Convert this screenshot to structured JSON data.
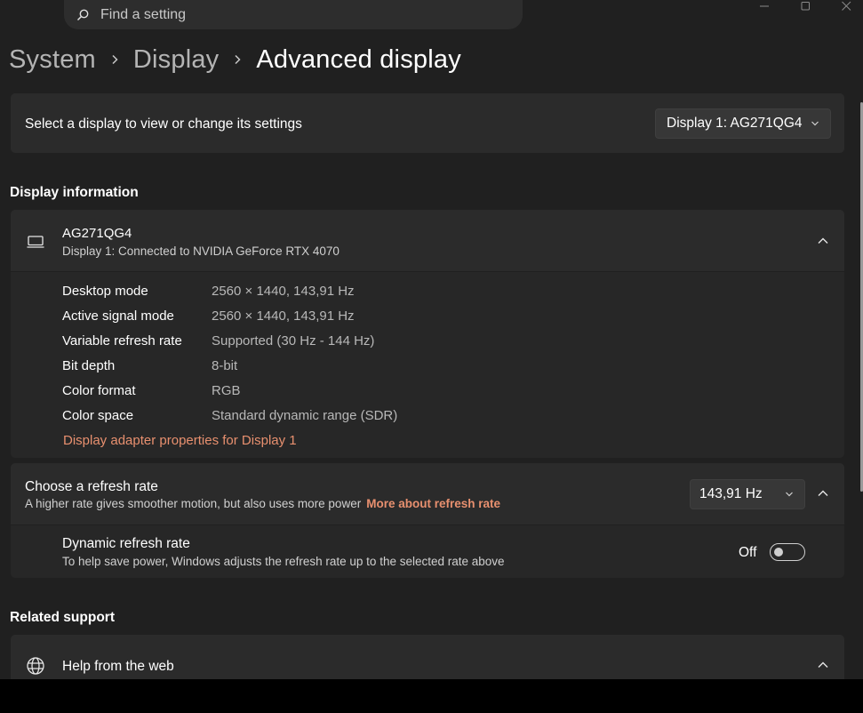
{
  "search": {
    "placeholder": "Find a setting"
  },
  "breadcrumb": {
    "items": [
      "System",
      "Display",
      "Advanced display"
    ]
  },
  "display_select": {
    "label": "Select a display to view or change its settings",
    "selected": "Display 1: AG271QG4"
  },
  "display_information": {
    "section_title": "Display information",
    "monitor_name": "AG271QG4",
    "connection": "Display 1: Connected to NVIDIA GeForce RTX 4070",
    "rows": [
      {
        "key": "Desktop mode",
        "value": "2560 × 1440, 143,91 Hz"
      },
      {
        "key": "Active signal mode",
        "value": "2560 × 1440, 143,91 Hz"
      },
      {
        "key": "Variable refresh rate",
        "value": "Supported (30 Hz - 144 Hz)"
      },
      {
        "key": "Bit depth",
        "value": "8-bit"
      },
      {
        "key": "Color format",
        "value": "RGB"
      },
      {
        "key": "Color space",
        "value": "Standard dynamic range (SDR)"
      }
    ],
    "adapter_link": "Display adapter properties for Display 1"
  },
  "refresh_rate": {
    "title": "Choose a refresh rate",
    "description": "A higher rate gives smoother motion, but also uses more power",
    "more_link": "More about refresh rate",
    "selected": "143,91 Hz"
  },
  "dynamic_refresh": {
    "title": "Dynamic refresh rate",
    "description": "To help save power, Windows adjusts the refresh rate up to the selected rate above",
    "state_label": "Off"
  },
  "related_support": {
    "section_title": "Related support",
    "help_title": "Help from the web"
  },
  "colors": {
    "background": "#202020",
    "card": "#2b2b2b",
    "accent_link": "#e8906f"
  }
}
